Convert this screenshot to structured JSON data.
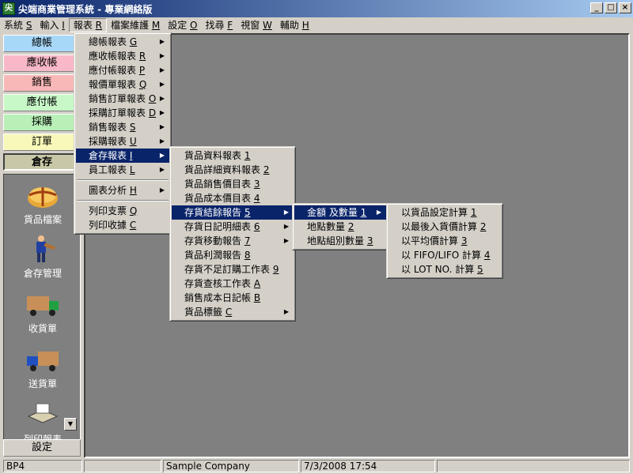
{
  "window": {
    "title": "尖端商業管理系統 - 專業網絡版",
    "app_icon": "尖",
    "controls": {
      "minimize": "_",
      "maximize": "□",
      "close": "×"
    }
  },
  "menubar": [
    {
      "label": "系統",
      "key": "S"
    },
    {
      "label": "輸入",
      "key": "I"
    },
    {
      "label": "報表",
      "key": "R"
    },
    {
      "label": "檔案維護",
      "key": "M"
    },
    {
      "label": "設定",
      "key": "O"
    },
    {
      "label": "找尋",
      "key": "F"
    },
    {
      "label": "視窗",
      "key": "W"
    },
    {
      "label": "輔助",
      "key": "H"
    }
  ],
  "left_panel": {
    "categories": [
      {
        "label": "總帳",
        "color": "#a8d8f8"
      },
      {
        "label": "應收帳",
        "color": "#f8b8c8"
      },
      {
        "label": "銷售",
        "color": "#f8b8b8"
      },
      {
        "label": "應付帳",
        "color": "#c8f8c8"
      },
      {
        "label": "採購",
        "color": "#b8f0b8"
      },
      {
        "label": "訂單",
        "color": "#f8f8b8"
      },
      {
        "label": "倉存",
        "color": "#c8c8a8"
      }
    ],
    "icons": [
      {
        "label": "貨品檔案",
        "icon": "package-icon"
      },
      {
        "label": "倉存管理",
        "icon": "worker-icon"
      },
      {
        "label": "收貨單",
        "icon": "truck-icon"
      },
      {
        "label": "送貨單",
        "icon": "truck-icon"
      },
      {
        "label": "列印報表",
        "icon": "printer-icon"
      }
    ],
    "scroll_arrow": "▼",
    "settings_label": "設定"
  },
  "report_menu": [
    {
      "label": "總帳報表",
      "key": "G",
      "submenu": true
    },
    {
      "label": "應收帳報表",
      "key": "R",
      "submenu": true
    },
    {
      "label": "應付帳報表",
      "key": "P",
      "submenu": true
    },
    {
      "label": "報價單報表",
      "key": "Q",
      "submenu": true
    },
    {
      "label": "銷售訂單報表",
      "key": "O",
      "submenu": true
    },
    {
      "label": "採購訂單報表",
      "key": "D",
      "submenu": true
    },
    {
      "label": "銷售報表",
      "key": "S",
      "submenu": true
    },
    {
      "label": "採購報表",
      "key": "U",
      "submenu": true
    },
    {
      "label": "倉存報表",
      "key": "I",
      "submenu": true,
      "highlighted": true
    },
    {
      "label": "員工報表",
      "key": "L",
      "submenu": true
    },
    {
      "separator": true
    },
    {
      "label": "圖表分析",
      "key": "H",
      "submenu": true
    },
    {
      "separator": true
    },
    {
      "label": "列印支票",
      "key": "Q",
      "submenu": false
    },
    {
      "label": "列印收據",
      "key": "C",
      "submenu": false
    }
  ],
  "inventory_menu": [
    {
      "label": "貨品資料報表",
      "key": "1",
      "submenu": false
    },
    {
      "label": "貨品詳細資料報表",
      "key": "2",
      "submenu": false
    },
    {
      "label": "貨品銷售價目表",
      "key": "3",
      "submenu": false
    },
    {
      "label": "貨品成本價目表",
      "key": "4",
      "submenu": false
    },
    {
      "label": "存貨結餘報告",
      "key": "5",
      "submenu": true,
      "highlighted": true
    },
    {
      "label": "存貨日記明細表",
      "key": "6",
      "submenu": true
    },
    {
      "label": "存貨移動報告",
      "key": "7",
      "submenu": true
    },
    {
      "label": "貨品利潤報告",
      "key": "8",
      "submenu": false
    },
    {
      "label": "存貨不足訂購工作表",
      "key": "9",
      "submenu": false
    },
    {
      "label": "存貨查核工作表",
      "key": "A",
      "submenu": false
    },
    {
      "label": "銷售成本日記帳",
      "key": "B",
      "submenu": false
    },
    {
      "label": "貨品標籤",
      "key": "C",
      "submenu": true
    }
  ],
  "balance_menu": [
    {
      "label": "金額 及數量",
      "key": "1",
      "submenu": true,
      "highlighted": true
    },
    {
      "label": "地點數量",
      "key": "2",
      "submenu": false
    },
    {
      "label": "地點組別數量",
      "key": "3",
      "submenu": false
    }
  ],
  "calc_menu": [
    {
      "label": "以貨品設定計算",
      "key": "1"
    },
    {
      "label": "以最後入貨價計算",
      "key": "2"
    },
    {
      "label": "以平均價計算",
      "key": "3"
    },
    {
      "label": "以 FIFO/LIFO 計算",
      "key": "4"
    },
    {
      "label": "以 LOT NO. 計算",
      "key": "5"
    }
  ],
  "statusbar": [
    "BP4",
    "",
    "Sample Company",
    "7/3/2008 17:54",
    ""
  ],
  "colors": {
    "highlight": "#0a246a",
    "face": "#d4d0c8",
    "client": "#808080"
  }
}
